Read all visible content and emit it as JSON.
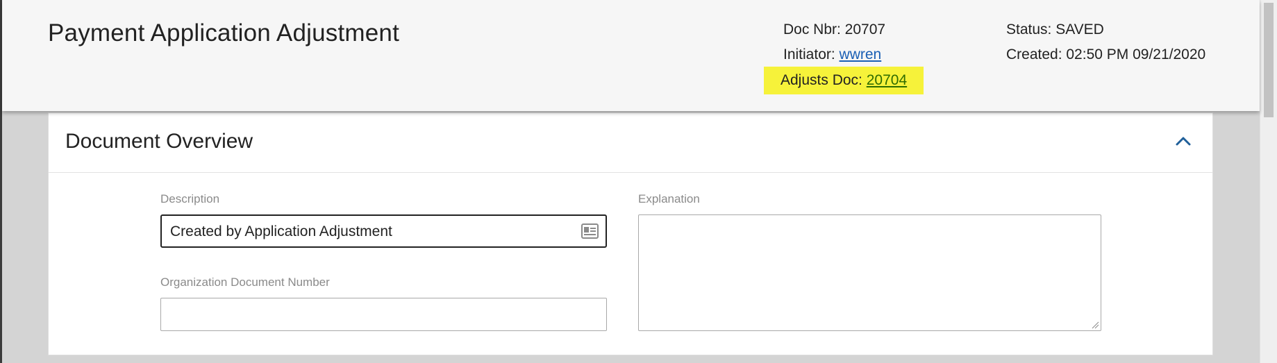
{
  "header": {
    "title": "Payment Application Adjustment",
    "doc_nbr_label": "Doc Nbr: 20707",
    "initiator_label": "Initiator:",
    "initiator_value": "wwren",
    "adjusts_doc_label": "Adjusts Doc:",
    "adjusts_doc_value": "20704",
    "status_label": "Status: SAVED",
    "created_label": "Created: 02:50 PM 09/21/2020"
  },
  "overview": {
    "title": "Document Overview",
    "collapse_icon": "chevron-up-icon",
    "description_label": "Description",
    "description_value": "Created by Application Adjustment",
    "description_icon": "id-card-icon",
    "org_doc_number_label": "Organization Document Number",
    "org_doc_number_value": "",
    "explanation_label": "Explanation",
    "explanation_value": ""
  },
  "colors": {
    "highlight": "#f6f23a",
    "link": "#1a5fb4",
    "accent": "#1f5f99"
  }
}
